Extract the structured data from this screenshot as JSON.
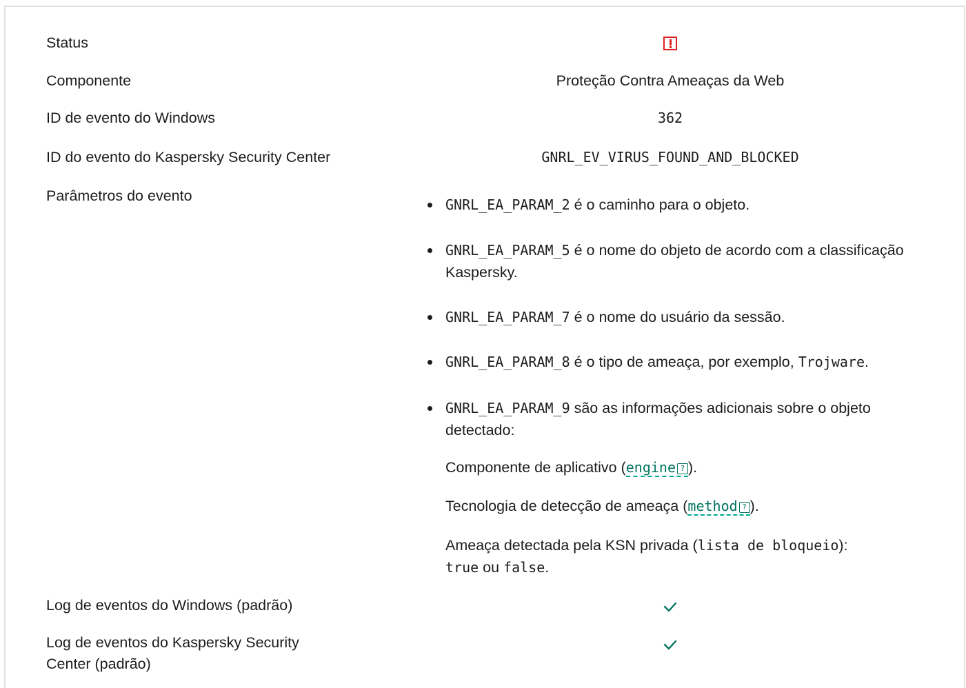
{
  "rows": {
    "status": {
      "label": "Status",
      "icon": "warning-icon",
      "color": "#e02020"
    },
    "component": {
      "label": "Componente",
      "value": "Proteção Contra Ameaças da Web"
    },
    "windows_event_id": {
      "label": "ID de evento do Windows",
      "value": "362"
    },
    "ksc_event_id": {
      "label": "ID do evento do Kaspersky Security Center",
      "value": "GNRL_EV_VIRUS_FOUND_AND_BLOCKED"
    },
    "event_params": {
      "label": "Parâmetros do evento"
    },
    "windows_log": {
      "label": "Log de eventos do Windows (padrão)",
      "icon": "checkmark-icon"
    },
    "ksc_log": {
      "label_line1": "Log de eventos do Kaspersky Security",
      "label_line2": "Center (padrão)",
      "icon": "checkmark-icon"
    }
  },
  "params": [
    {
      "code": "GNRL_EA_PARAM_2",
      "text": " é o caminho para o objeto."
    },
    {
      "code": "GNRL_EA_PARAM_5",
      "text": " é o nome do objeto de acordo com a classificação Kaspersky."
    },
    {
      "code": "GNRL_EA_PARAM_7",
      "text": " é o nome do usuário da sessão."
    },
    {
      "code": "GNRL_EA_PARAM_8",
      "text": " é o tipo de ameaça, por exemplo, ",
      "example": "Trojware",
      "suffix": "."
    },
    {
      "code": "GNRL_EA_PARAM_9",
      "text": " são as informações adicionais sobre o objeto detectado:"
    }
  ],
  "details": {
    "engine": {
      "prefix": "Componente de aplicativo (",
      "term": "engine",
      "suffix": ")."
    },
    "method": {
      "prefix": "Tecnologia de detecção de ameaça (",
      "term": "method",
      "suffix": ")."
    },
    "ksn": {
      "prefix": "Ameaça detectada pela KSN privada (",
      "code": "lista de bloqueio",
      "after": "): ",
      "true_val": "true",
      "or": " ou ",
      "false_val": "false",
      "suffix": "."
    }
  },
  "help_glyph": "?",
  "colors": {
    "accent": "#00735f",
    "check": "#00735f",
    "warning": "#e02020"
  }
}
